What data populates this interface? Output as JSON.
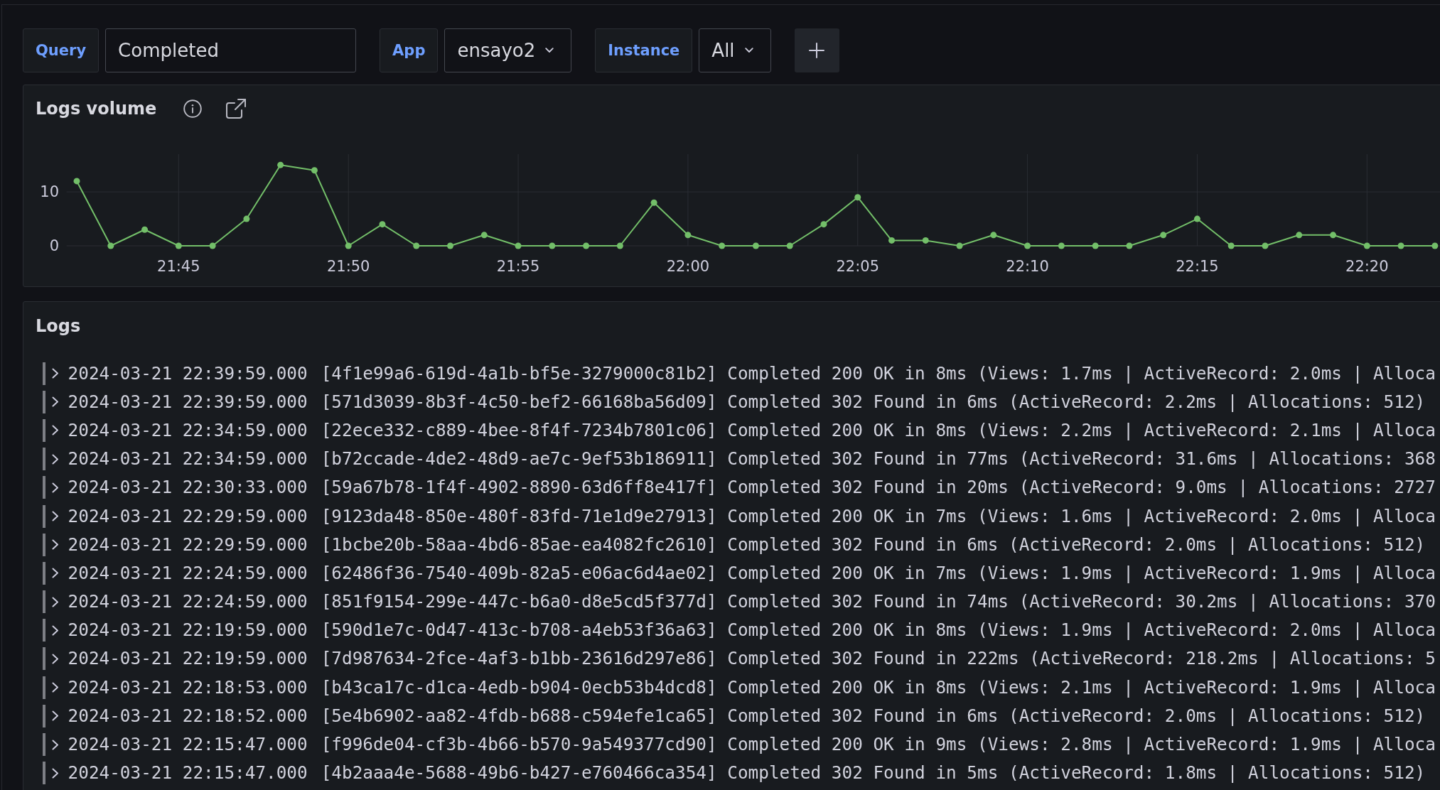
{
  "filters": [
    {
      "kind": "text",
      "label": "Query",
      "value": "Completed"
    },
    {
      "kind": "select",
      "label": "App",
      "value": "ensayo2"
    },
    {
      "kind": "select",
      "label": "Instance",
      "value": "All"
    }
  ],
  "logs_volume": {
    "title": "Logs volume",
    "chart_data": {
      "type": "line",
      "x": [
        1302,
        1303,
        1304,
        1305,
        1306,
        1307,
        1308,
        1309,
        1310,
        1311,
        1312,
        1313,
        1314,
        1315,
        1316,
        1317,
        1318,
        1319,
        1320,
        1321,
        1322,
        1323,
        1324,
        1325,
        1326,
        1327,
        1328,
        1329,
        1330,
        1331,
        1332,
        1333,
        1334,
        1335,
        1336,
        1337,
        1338,
        1339,
        1340,
        1341,
        1342
      ],
      "series": [
        {
          "color": "#73bf69",
          "marker": "circle",
          "values": [
            12,
            0,
            3,
            0,
            0,
            5,
            15,
            14,
            0,
            4,
            0,
            0,
            2,
            0,
            0,
            0,
            0,
            8,
            2,
            0,
            0,
            0,
            4,
            9,
            1,
            1,
            0,
            2,
            0,
            0,
            0,
            0,
            2,
            5,
            0,
            0,
            2,
            2,
            0,
            0,
            0
          ]
        }
      ],
      "xlim": [
        1301.7,
        1342.15
      ],
      "ylim": [
        0,
        17
      ],
      "xticks": [
        {
          "value": 1305,
          "label": "21:45"
        },
        {
          "value": 1310,
          "label": "21:50"
        },
        {
          "value": 1315,
          "label": "21:55"
        },
        {
          "value": 1320,
          "label": "22:00"
        },
        {
          "value": 1325,
          "label": "22:05"
        },
        {
          "value": 1330,
          "label": "22:10"
        },
        {
          "value": 1335,
          "label": "22:15"
        },
        {
          "value": 1340,
          "label": "22:20"
        }
      ],
      "yticks": [
        0,
        10
      ],
      "grid": true
    }
  },
  "logs": {
    "title": "Logs",
    "rows": [
      {
        "timestamp": "2024-03-21 22:39:59.000",
        "line": "[4f1e99a6-619d-4a1b-bf5e-3279000c81b2] Completed 200 OK in 8ms (Views: 1.7ms | ActiveRecord: 2.0ms | Alloca",
        "expanded": false
      },
      {
        "timestamp": "2024-03-21 22:39:59.000",
        "line": "[571d3039-8b3f-4c50-bef2-66168ba56d09] Completed 302 Found in 6ms (ActiveRecord: 2.2ms | Allocations: 512)",
        "expanded": false
      },
      {
        "timestamp": "2024-03-21 22:34:59.000",
        "line": "[22ece332-c889-4bee-8f4f-7234b7801c06] Completed 200 OK in 8ms (Views: 2.2ms | ActiveRecord: 2.1ms | Alloca",
        "expanded": false
      },
      {
        "timestamp": "2024-03-21 22:34:59.000",
        "line": "[b72ccade-4de2-48d9-ae7c-9ef53b186911] Completed 302 Found in 77ms (ActiveRecord: 31.6ms | Allocations: 368",
        "expanded": false
      },
      {
        "timestamp": "2024-03-21 22:30:33.000",
        "line": "[59a67b78-1f4f-4902-8890-63d6ff8e417f] Completed 302 Found in 20ms (ActiveRecord: 9.0ms | Allocations: 2727",
        "expanded": false
      },
      {
        "timestamp": "2024-03-21 22:29:59.000",
        "line": "[9123da48-850e-480f-83fd-71e1d9e27913] Completed 200 OK in 7ms (Views: 1.6ms | ActiveRecord: 2.0ms | Alloca",
        "expanded": false
      },
      {
        "timestamp": "2024-03-21 22:29:59.000",
        "line": "[1bcbe20b-58aa-4bd6-85ae-ea4082fc2610] Completed 302 Found in 6ms (ActiveRecord: 2.0ms | Allocations: 512)",
        "expanded": false
      },
      {
        "timestamp": "2024-03-21 22:24:59.000",
        "line": "[62486f36-7540-409b-82a5-e06ac6d4ae02] Completed 200 OK in 7ms (Views: 1.9ms | ActiveRecord: 1.9ms | Alloca",
        "expanded": false
      },
      {
        "timestamp": "2024-03-21 22:24:59.000",
        "line": "[851f9154-299e-447c-b6a0-d8e5cd5f377d] Completed 302 Found in 74ms (ActiveRecord: 30.2ms | Allocations: 370",
        "expanded": false
      },
      {
        "timestamp": "2024-03-21 22:19:59.000",
        "line": "[590d1e7c-0d47-413c-b708-a4eb53f36a63] Completed 200 OK in 8ms (Views: 1.9ms | ActiveRecord: 2.0ms | Alloca",
        "expanded": false
      },
      {
        "timestamp": "2024-03-21 22:19:59.000",
        "line": "[7d987634-2fce-4af3-b1bb-23616d297e86] Completed 302 Found in 222ms (ActiveRecord: 218.2ms | Allocations: 5",
        "expanded": false
      },
      {
        "timestamp": "2024-03-21 22:18:53.000",
        "line": "[b43ca17c-d1ca-4edb-b904-0ecb53b4dcd8] Completed 200 OK in 8ms (Views: 2.1ms | ActiveRecord: 1.9ms | Alloca",
        "expanded": false
      },
      {
        "timestamp": "2024-03-21 22:18:52.000",
        "line": "[5e4b6902-aa82-4fdb-b688-c594efe1ca65] Completed 302 Found in 6ms (ActiveRecord: 2.0ms | Allocations: 512)",
        "expanded": false
      },
      {
        "timestamp": "2024-03-21 22:15:47.000",
        "line": "[f996de04-cf3b-4b66-b570-9a549377cd90] Completed 200 OK in 9ms (Views: 2.8ms | ActiveRecord: 1.9ms | Alloca",
        "expanded": false
      },
      {
        "timestamp": "2024-03-21 22:15:47.000",
        "line": "[4b2aaa4e-5688-49b6-b427-e760466ca354] Completed 302 Found in 5ms (ActiveRecord: 1.8ms | Allocations: 512)",
        "expanded": false
      }
    ]
  }
}
